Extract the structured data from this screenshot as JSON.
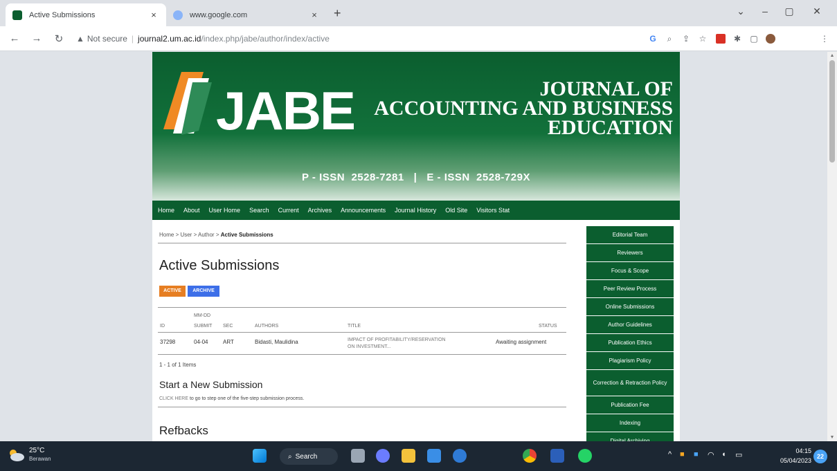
{
  "browser": {
    "tabs": [
      {
        "label": "Active Submissions",
        "close": "×"
      },
      {
        "label": "www.google.com",
        "close": "×"
      }
    ],
    "new_tab": "+",
    "window_controls": {
      "chevron": "⌄",
      "minimize": "–",
      "maximize": "▢",
      "close": "✕"
    },
    "nav": {
      "back": "←",
      "forward": "→",
      "reload": "↻"
    },
    "security": "Not secure",
    "url_host": "journal2.um.ac.id",
    "url_path": "/index.php/jabe/author/index/active"
  },
  "site": {
    "logo_text": "JABE",
    "journal_title": [
      "JOURNAL OF",
      "ACCOUNTING AND BUSINESS",
      "EDUCATION"
    ],
    "issn": "P - ISSN  2528-7281   |   E - ISSN  2528-729X",
    "nav": [
      "Home",
      "About",
      "User Home",
      "Search",
      "Current",
      "Archives",
      "Announcements",
      "Journal History",
      "Old Site",
      "Visitors Stat"
    ],
    "breadcrumb": {
      "path": "Home > User > Author > ",
      "current": "Active Submissions"
    },
    "heading": "Active Submissions",
    "buttons": {
      "active": "ACTIVE",
      "archive": "ARCHIVE"
    },
    "table": {
      "headers": {
        "id": "ID",
        "mmdd": "MM-DD",
        "submit": "SUBMIT",
        "sec": "SEC",
        "authors": "AUTHORS",
        "title": "TITLE",
        "status": "STATUS"
      },
      "rows": [
        {
          "id": "37298",
          "date": "04-04",
          "sec": "ART",
          "authors": "Bidasti, Maulidina",
          "title_line1": "IMPACT OF PROFITABILITY/RESERVATION",
          "title_line2": "ON INVESTMENT...",
          "status": "Awaiting assignment"
        }
      ]
    },
    "count": "1 - 1 of 1 Items",
    "new_submission_heading": "Start a New Submission",
    "click_here": "CLICK HERE",
    "click_here_rest": " to go to step one of the five-step submission process.",
    "refbacks_heading": "Refbacks",
    "sidebar": [
      "Editorial Team",
      "Reviewers",
      "Focus & Scope",
      "Peer Review Process",
      "Online Submissions",
      "Author Guidelines",
      "Publication Ethics",
      "Plagiarism Policy",
      "Correction & Retraction Policy",
      "Publication Fee",
      "Indexing",
      "Digital Archiving"
    ]
  },
  "taskbar": {
    "temp": "25°C",
    "weather": "Berawan",
    "search": "Search",
    "time": "04:15",
    "date": "05/04/2023",
    "notif": "22"
  },
  "colors": {
    "brand_green": "#0b5e2f",
    "active_orange": "#e67e22",
    "archive_blue": "#3d6fe8"
  }
}
